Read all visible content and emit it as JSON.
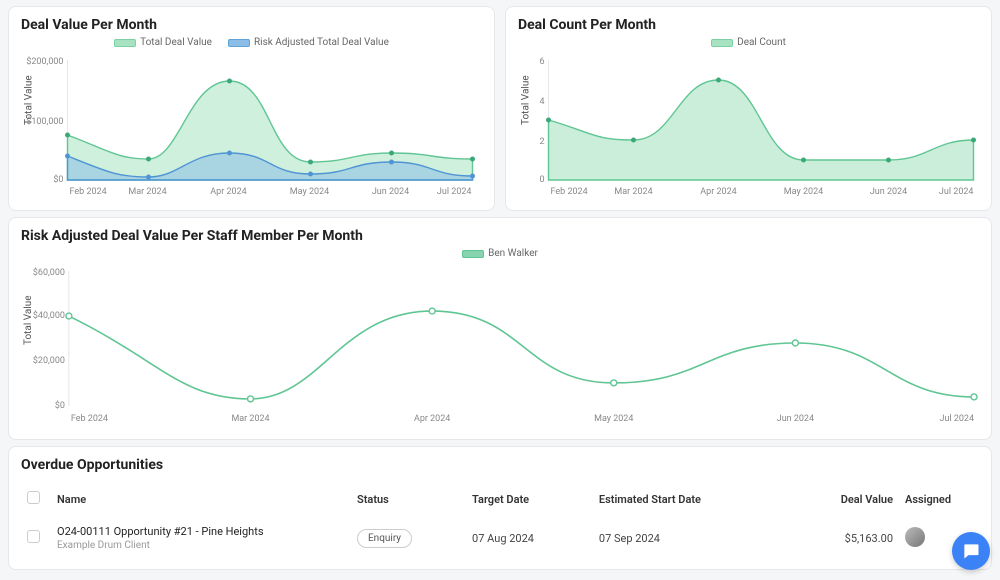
{
  "chart_data": [
    {
      "type": "area",
      "id": "deal_value_per_month",
      "title": "Deal Value Per Month",
      "xlabel": "",
      "ylabel": "Total Value",
      "categories": [
        "Feb 2024",
        "Mar 2024",
        "Apr 2024",
        "May 2024",
        "Jun 2024",
        "Jul 2024"
      ],
      "ylim": [
        0,
        200000
      ],
      "yticks": [
        0,
        100000,
        200000
      ],
      "ytick_labels": [
        "$0",
        "$100,000",
        "$200,000"
      ],
      "series": [
        {
          "name": "Total Deal Value",
          "color": "#a7e3c0",
          "values": [
            75000,
            35000,
            165000,
            30000,
            45000,
            35000
          ]
        },
        {
          "name": "Risk Adjusted Total Deal Value",
          "color": "#8bbde6",
          "values": [
            40000,
            5000,
            45000,
            10000,
            30000,
            7000
          ]
        }
      ]
    },
    {
      "type": "area",
      "id": "deal_count_per_month",
      "title": "Deal Count Per Month",
      "xlabel": "",
      "ylabel": "Total Value",
      "categories": [
        "Feb 2024",
        "Mar 2024",
        "Apr 2024",
        "May 2024",
        "Jun 2024",
        "Jul 2024"
      ],
      "ylim": [
        0,
        6
      ],
      "yticks": [
        0,
        2,
        4,
        6
      ],
      "series": [
        {
          "name": "Deal Count",
          "color": "#a7e3c0",
          "values": [
            3,
            2,
            5,
            1,
            1,
            2
          ]
        }
      ]
    },
    {
      "type": "line",
      "id": "risk_adjusted_deal_value_staff",
      "title": "Risk Adjusted Deal Value Per Staff Member Per Month",
      "xlabel": "",
      "ylabel": "Total Value",
      "categories": [
        "Feb 2024",
        "Mar 2024",
        "Apr 2024",
        "May 2024",
        "Jun 2024",
        "Jul 2024"
      ],
      "ylim": [
        0,
        60000
      ],
      "yticks": [
        0,
        20000,
        40000,
        60000
      ],
      "ytick_labels": [
        "$0",
        "$20,000",
        "$40,000",
        "$60,000"
      ],
      "series": [
        {
          "name": "Ben Walker",
          "color": "#86d4b0",
          "values": [
            40000,
            3000,
            42000,
            10000,
            28000,
            4000
          ]
        }
      ]
    }
  ],
  "overdue": {
    "title": "Overdue Opportunities",
    "columns": {
      "name": "Name",
      "status": "Status",
      "target_date": "Target Date",
      "estimated_start": "Estimated Start Date",
      "deal_value": "Deal Value",
      "assigned": "Assigned"
    },
    "rows": [
      {
        "name": "O24-00111 Opportunity #21 - Pine Heights",
        "client": "Example Drum Client",
        "status": "Enquiry",
        "target_date": "07 Aug 2024",
        "estimated_start": "07 Sep 2024",
        "deal_value": "$5,163.00"
      }
    ]
  },
  "ui": {
    "chat_label": "chat"
  }
}
